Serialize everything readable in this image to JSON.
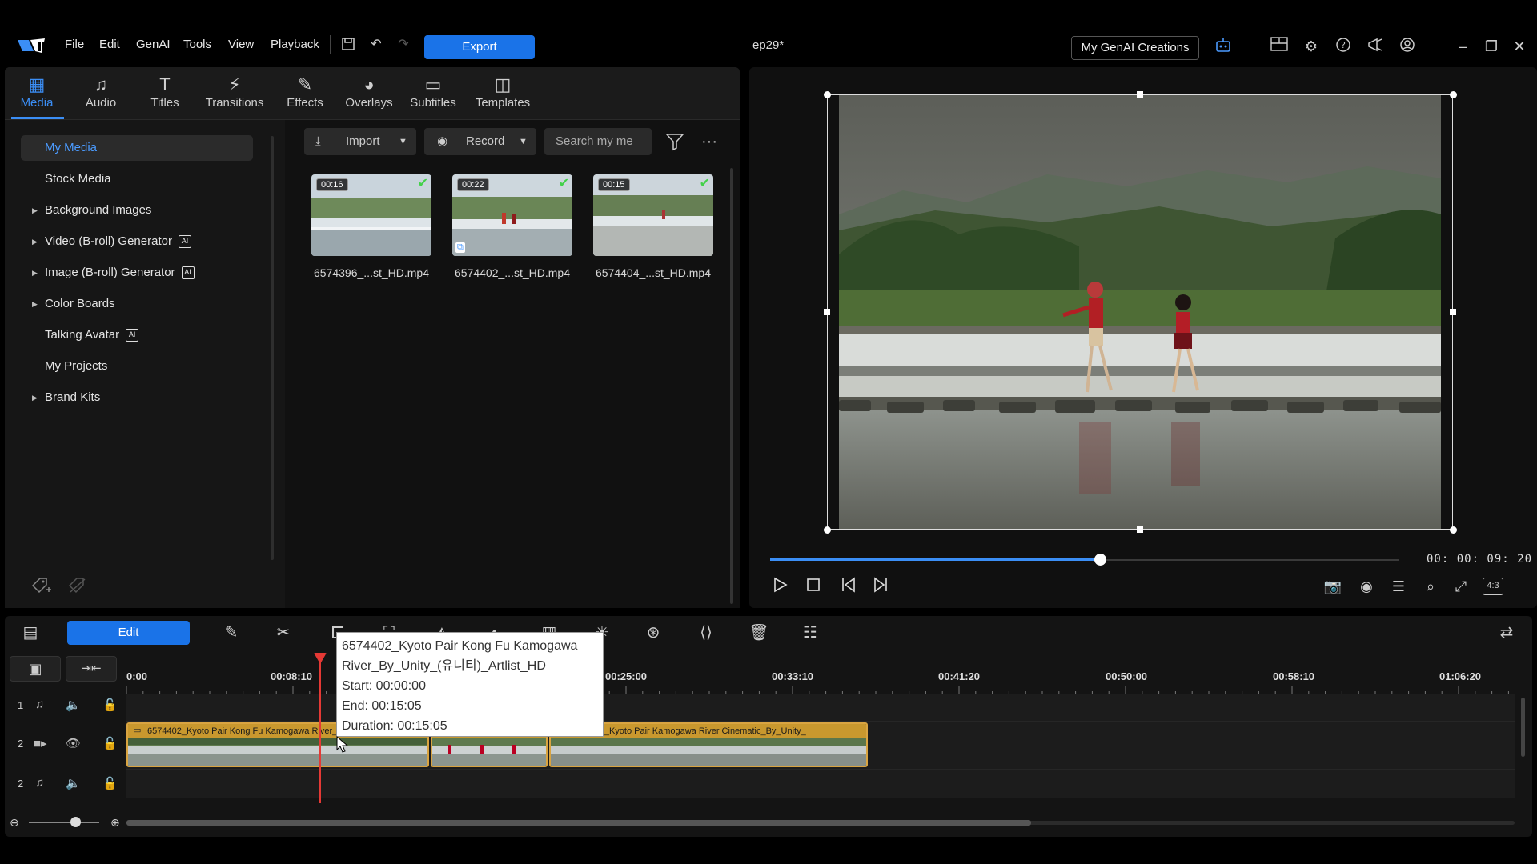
{
  "menu": {
    "items": [
      "File",
      "Edit",
      "GenAI",
      "Tools",
      "View",
      "Playback"
    ],
    "export_label": "Export",
    "document_title": "ep29*",
    "genai_creations_label": "My GenAI Creations"
  },
  "tabs": [
    {
      "label": "Media",
      "icon": "media-icon"
    },
    {
      "label": "Audio",
      "icon": "music-note-icon"
    },
    {
      "label": "Titles",
      "icon": "text-icon"
    },
    {
      "label": "Transitions",
      "icon": "transitions-icon"
    },
    {
      "label": "Effects",
      "icon": "effects-icon"
    },
    {
      "label": "Overlays",
      "icon": "overlays-icon"
    },
    {
      "label": "Subtitles",
      "icon": "subtitles-icon"
    },
    {
      "label": "Templates",
      "icon": "templates-icon"
    }
  ],
  "sidebar": {
    "items": [
      {
        "label": "My Media"
      },
      {
        "label": "Stock Media"
      },
      {
        "label": "Background Images"
      },
      {
        "label": "Video (B-roll) Generator"
      },
      {
        "label": "Image (B-roll) Generator"
      },
      {
        "label": "Color Boards"
      },
      {
        "label": "Talking Avatar"
      },
      {
        "label": "My Projects"
      },
      {
        "label": "Brand Kits"
      }
    ]
  },
  "library": {
    "import_label": "Import",
    "record_label": "Record",
    "search_placeholder": "Search my me",
    "items": [
      {
        "duration": "00:16",
        "name": "6574396_...st_HD.mp4"
      },
      {
        "duration": "00:22",
        "name": "6574402_...st_HD.mp4"
      },
      {
        "duration": "00:15",
        "name": "6574404_...st_HD.mp4"
      }
    ]
  },
  "preview": {
    "timecode": "00: 00: 09: 20",
    "progress_fraction": 0.525,
    "aspect_label": "4:3"
  },
  "timeline": {
    "edit_label": "Edit",
    "ruler": [
      "0:00",
      "00:08:10",
      "00:25:00",
      "00:33:10",
      "00:41:20",
      "00:50:00",
      "00:58:10",
      "01:06:20"
    ],
    "tracks": [
      {
        "num": "1",
        "type": "audio"
      },
      {
        "num": "2",
        "type": "video"
      },
      {
        "num": "2",
        "type": "audio"
      }
    ],
    "clips": [
      {
        "title": "6574402_Kyoto Pair Kong Fu Kamogawa River_By_Unity_(유니티)_Artlist_HD"
      },
      {
        "title": ""
      },
      {
        "title": "6574396_Kyoto Pair Kamogawa River Cinematic_By_Unity_"
      }
    ],
    "tooltip": {
      "line1": "6574402_Kyoto Pair Kong Fu Kamogawa",
      "line2": "River_By_Unity_(유니티)_Artlist_HD",
      "start": "Start: 00:00:00",
      "end": "End: 00:15:05",
      "duration": "Duration: 00:15:05"
    }
  },
  "colors": {
    "accent": "#1a73e8",
    "clip_border": "#d9a441",
    "playhead": "#e53935"
  }
}
